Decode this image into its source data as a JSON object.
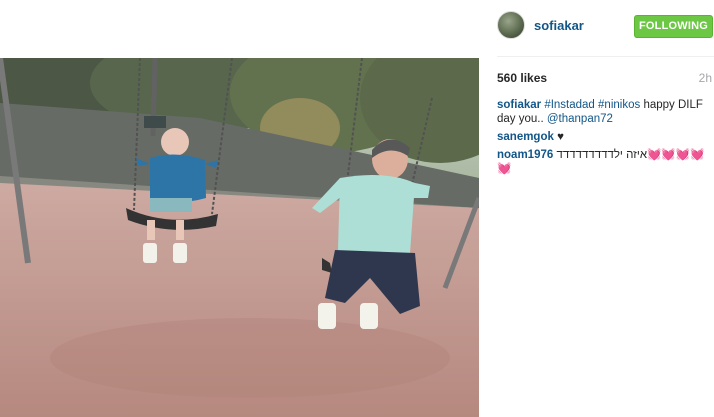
{
  "post": {
    "username": "sofiakar",
    "follow_label": "FOLLOWING",
    "likes": "560 likes",
    "time_ago": "2h",
    "caption": {
      "user": "sofiakar",
      "tags": [
        "#Instadad",
        "#ninikos"
      ],
      "text_plain": "happy DILF day you..",
      "mention": "@thanpan72"
    },
    "comments": [
      {
        "user": "sanemgok",
        "text": "♥"
      },
      {
        "user": "noam1976",
        "text": "איזה ילדדדדדדדדד💓💓💓💓💓"
      }
    ]
  },
  "icons": {
    "avatar": "profile-avatar",
    "photo": "swing-photo"
  },
  "colors": {
    "link": "#125688",
    "follow_bg": "#6bc744",
    "muted": "#a5a7aa"
  }
}
